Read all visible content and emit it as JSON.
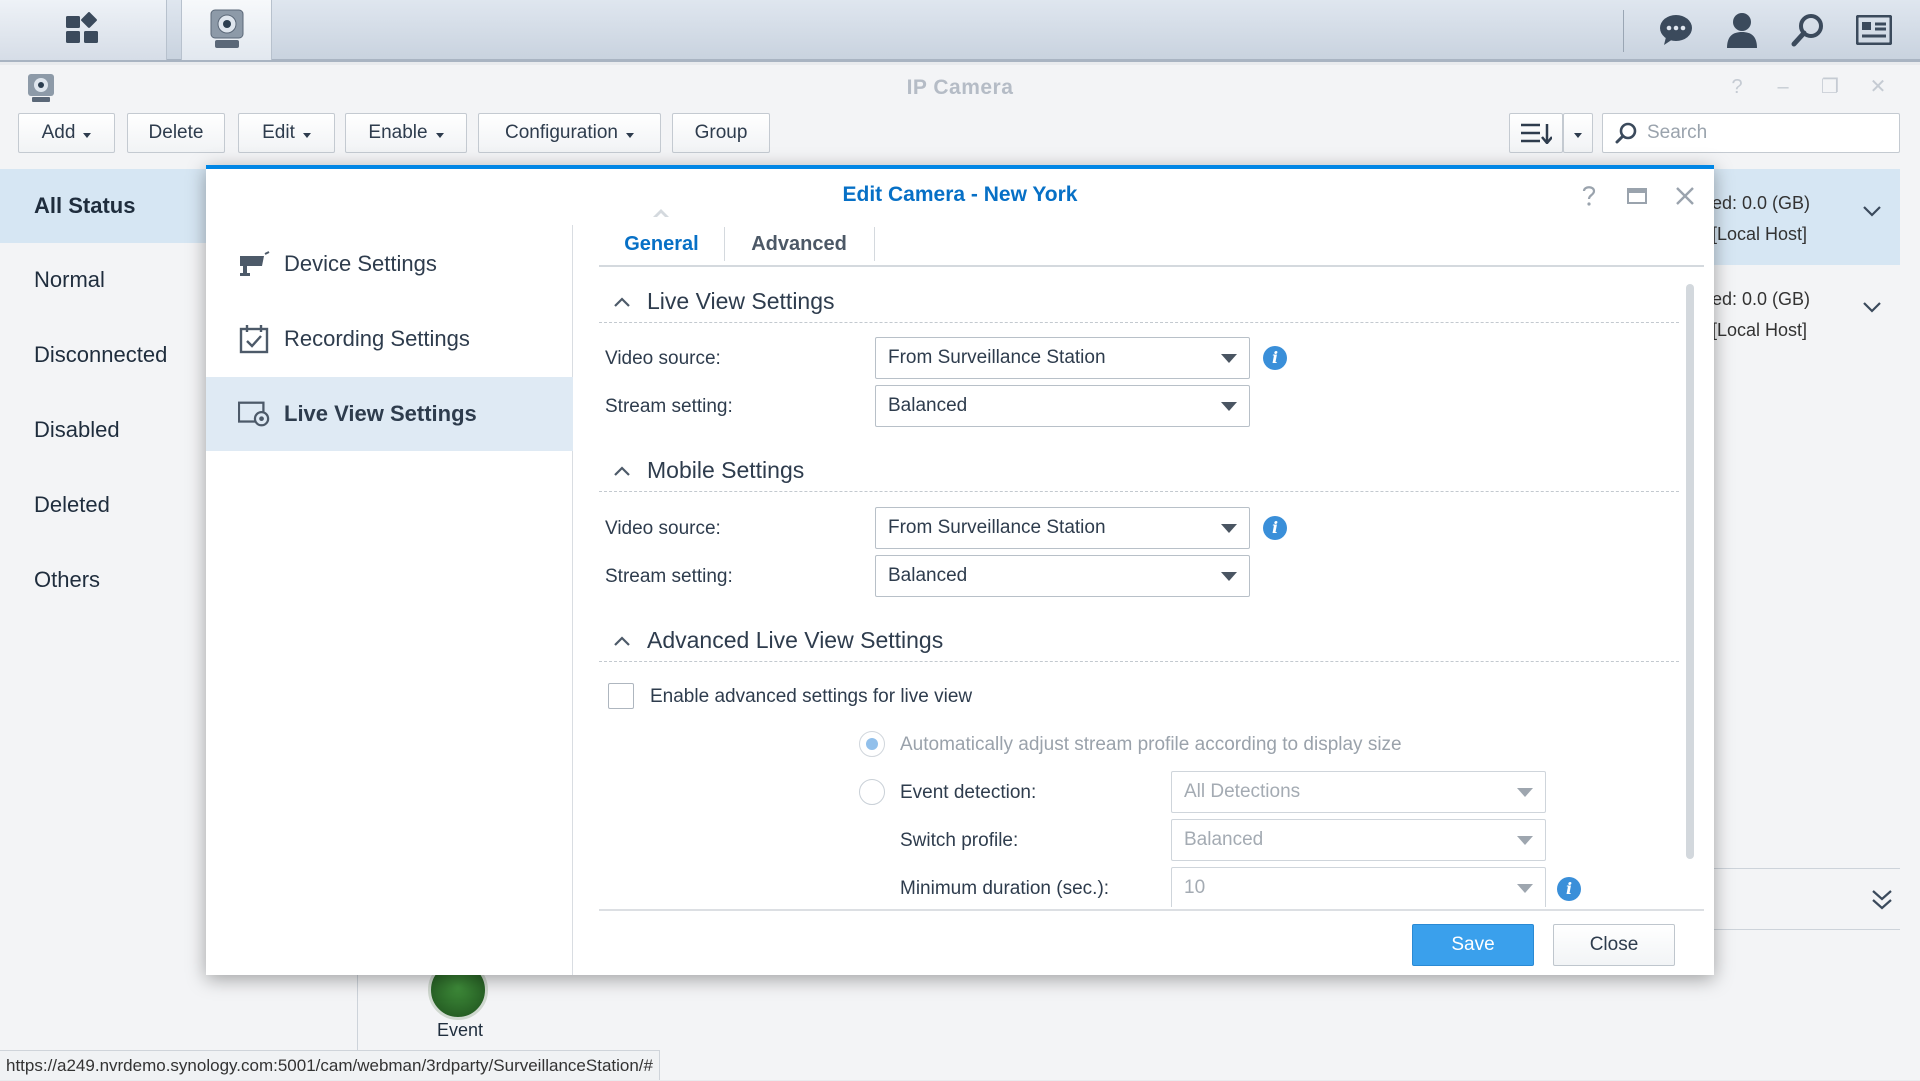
{
  "app": {
    "title": "IP Camera"
  },
  "toolbar": {
    "add": "Add",
    "delete": "Delete",
    "edit": "Edit",
    "enable": "Enable",
    "configuration": "Configuration",
    "group": "Group",
    "search_placeholder": "Search"
  },
  "status_list": [
    "All Status",
    "Normal",
    "Disconnected",
    "Disabled",
    "Deleted",
    "Others"
  ],
  "background_rows": [
    {
      "storage": "ed: 0.0 (GB)",
      "host": "[Local Host]"
    },
    {
      "storage": "ed: 0.0 (GB)",
      "host": "[Local Host]"
    }
  ],
  "event_label": "Event",
  "url": "https://a249.nvrdemo.synology.com:5001/cam/webman/3rdparty/SurveillanceStation/#",
  "dialog": {
    "title": "Edit Camera - New York",
    "sidebar": [
      "Device Settings",
      "Recording Settings",
      "Live View Settings"
    ],
    "tabs": [
      "General",
      "Advanced"
    ],
    "sections": {
      "live_view": {
        "title": "Live View Settings",
        "video_source_label": "Video source:",
        "video_source_value": "From Surveillance Station",
        "stream_label": "Stream setting:",
        "stream_value": "Balanced"
      },
      "mobile": {
        "title": "Mobile Settings",
        "video_source_label": "Video source:",
        "video_source_value": "From Surveillance Station",
        "stream_label": "Stream setting:",
        "stream_value": "Balanced"
      },
      "advanced": {
        "title": "Advanced Live View Settings",
        "enable_label": "Enable advanced settings for live view",
        "auto_adjust_label": "Automatically adjust stream profile according to display size",
        "event_detection_label": "Event detection:",
        "event_detection_value": "All Detections",
        "switch_profile_label": "Switch profile:",
        "switch_profile_value": "Balanced",
        "min_duration_label": "Minimum duration (sec.):",
        "min_duration_value": "10"
      }
    },
    "save": "Save",
    "close": "Close"
  },
  "colors": {
    "accent": "#0086e5",
    "title_blue": "#0770c6",
    "save_button": "#3aa0ec",
    "active_row": "#d6e6f3"
  }
}
